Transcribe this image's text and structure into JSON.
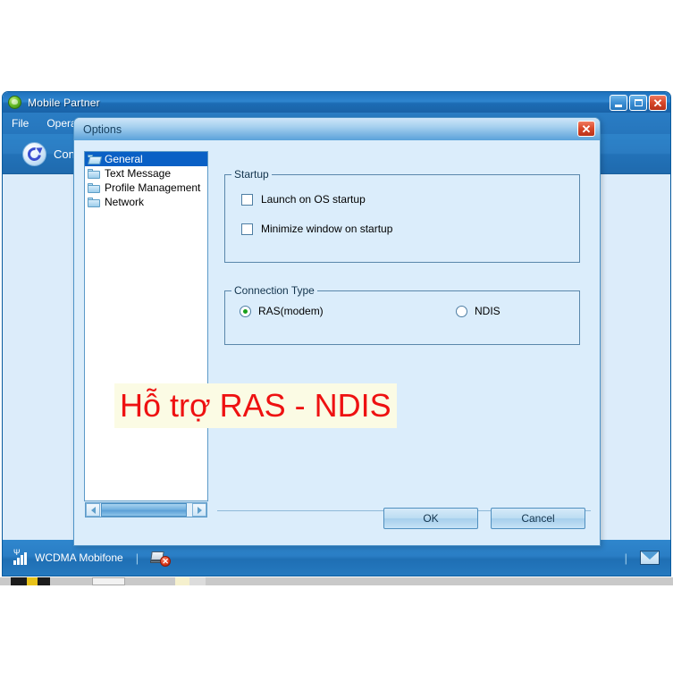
{
  "main_window": {
    "title": "Mobile Partner",
    "app_icon": "globe-green-icon",
    "controls": {
      "minimize": "minimize-icon",
      "maximize": "maximize-icon",
      "close": "✕"
    },
    "menu": [
      {
        "label": "File"
      },
      {
        "label": "Operati"
      }
    ],
    "toolbar": {
      "refresh_icon": "refresh-circular-arrows-icon",
      "connection_label": "Con"
    }
  },
  "status_bar": {
    "signal_icon": "signal-bars-icon",
    "network_text": "WCDMA  Mobifone",
    "separator": "|",
    "modem_icon": "modem-disconnected-icon",
    "modem_badge": "✕",
    "mail_icon": "envelope-icon"
  },
  "options_dialog": {
    "title": "Options",
    "close_label": "✕",
    "tree": {
      "items": [
        {
          "label": "General",
          "icon": "folder-open-icon",
          "selected": true
        },
        {
          "label": "Text Message",
          "icon": "folder-icon",
          "selected": false
        },
        {
          "label": "Profile Management",
          "icon": "folder-icon",
          "selected": false
        },
        {
          "label": "Network",
          "icon": "folder-icon",
          "selected": false
        }
      ],
      "scrollbar": {
        "left_arrow": "chevron-left-icon",
        "right_arrow": "chevron-right-icon"
      }
    },
    "startup_group": {
      "legend": "Startup",
      "checkboxes": [
        {
          "label": "Launch on OS startup",
          "checked": false
        },
        {
          "label": "Minimize window on startup",
          "checked": false
        }
      ]
    },
    "connection_group": {
      "legend": "Connection Type",
      "radios": [
        {
          "label": "RAS(modem)",
          "checked": true
        },
        {
          "label": "NDIS",
          "checked": false
        }
      ]
    },
    "buttons": {
      "ok": "OK",
      "cancel": "Cancel"
    }
  },
  "annotation": {
    "text": "Hỗ trợ RAS - NDIS",
    "color": "#ee1111",
    "background": "#fbfbe4"
  }
}
